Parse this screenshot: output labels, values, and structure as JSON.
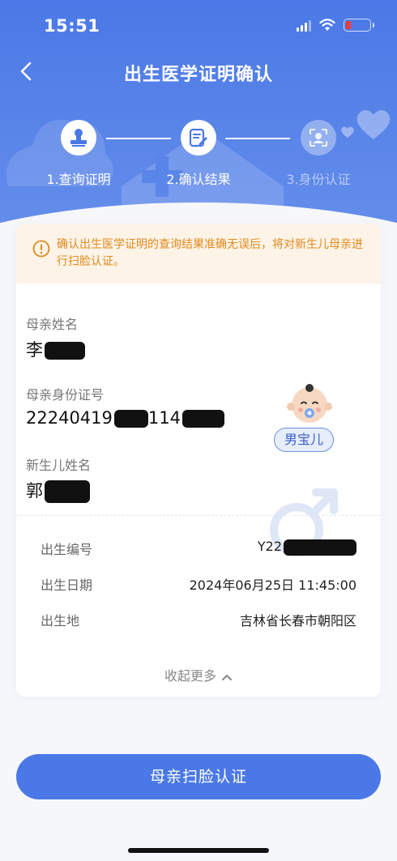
{
  "status_bar": {
    "time": "15:51"
  },
  "nav": {
    "title": "出生医学证明确认"
  },
  "steps": [
    {
      "label": "1.查询证明",
      "state": "done",
      "icon": "stamp-icon"
    },
    {
      "label": "2.确认结果",
      "state": "active",
      "icon": "edit-document-icon"
    },
    {
      "label": "3.身份认证",
      "state": "pending",
      "icon": "face-scan-icon"
    }
  ],
  "notice": {
    "text": "确认出生医学证明的查询结果准确无误后，将对新生儿母亲进行扫脸认证。",
    "icon": "warning-circle-icon"
  },
  "mother_name": {
    "label": "母亲姓名",
    "value": "李"
  },
  "mother_id": {
    "label": "母亲身份证号",
    "value_prefix": "22240419",
    "value_middle": "114"
  },
  "baby_name": {
    "label": "新生儿姓名",
    "value": "郭"
  },
  "gender": {
    "label": "男宝儿",
    "icon": "male-icon"
  },
  "details": [
    {
      "label": "出生编号",
      "value": "Y22"
    },
    {
      "label": "出生日期",
      "value": "2024年06月25日 11:45:00"
    },
    {
      "label": "出生地",
      "value": "吉林省长春市朝阳区"
    }
  ],
  "collapse": {
    "label": "收起更多"
  },
  "primary_button": {
    "label": "母亲扫脸认证"
  },
  "colors": {
    "primary": "#4a78e6",
    "warning": "#e08a1e",
    "warning_bg": "#fdf3e6"
  }
}
